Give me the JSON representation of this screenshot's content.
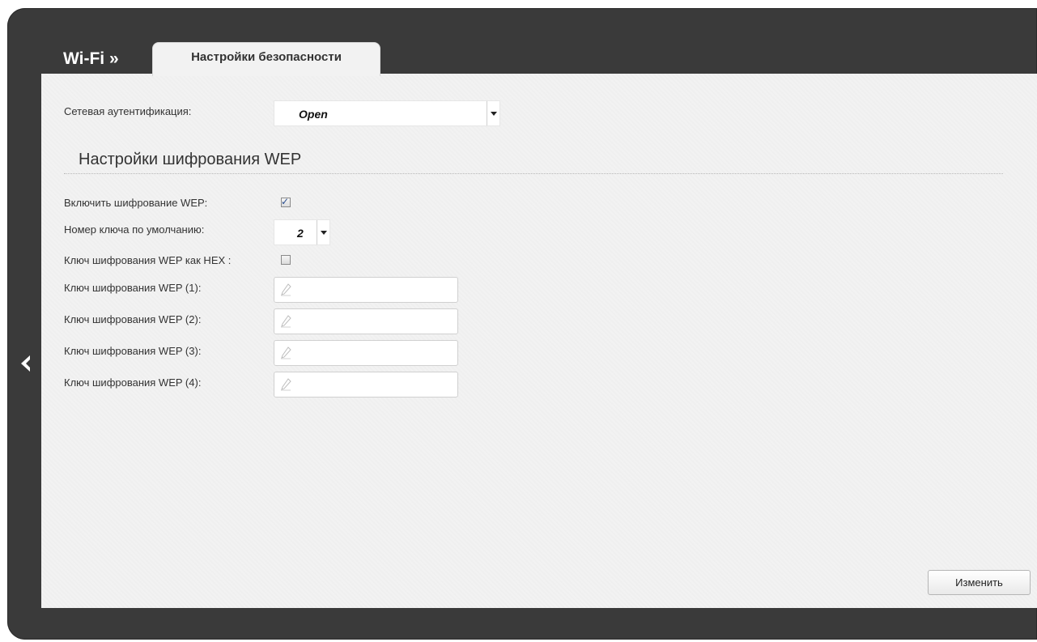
{
  "header": {
    "breadcrumb": "Wi-Fi »",
    "tab_label": "Настройки безопасности"
  },
  "auth": {
    "label": "Сетевая аутентификация:",
    "value": "Open"
  },
  "wep": {
    "section_title": "Настройки шифрования WEP",
    "enable_label": "Включить шифрование WEP:",
    "enable_checked": true,
    "default_key_label": "Номер ключа по умолчанию:",
    "default_key_value": "2",
    "hex_label": "Ключ шифрования WEP как HEX :",
    "hex_checked": false,
    "keys": [
      {
        "label": "Ключ шифрования WEP (1):",
        "value": ""
      },
      {
        "label": "Ключ шифрования WEP (2):",
        "value": ""
      },
      {
        "label": "Ключ шифрования WEP (3):",
        "value": ""
      },
      {
        "label": "Ключ шифрования WEP (4):",
        "value": ""
      }
    ]
  },
  "actions": {
    "change_label": "Изменить"
  },
  "icons": {
    "back": "chevron-left-icon",
    "pencil": "pencil-icon",
    "dropdown": "chevron-down-icon",
    "checkmark": "checkmark-icon"
  },
  "colors": {
    "frame": "#3a3a3a",
    "panel": "#f2f2f2",
    "text": "#333333"
  }
}
